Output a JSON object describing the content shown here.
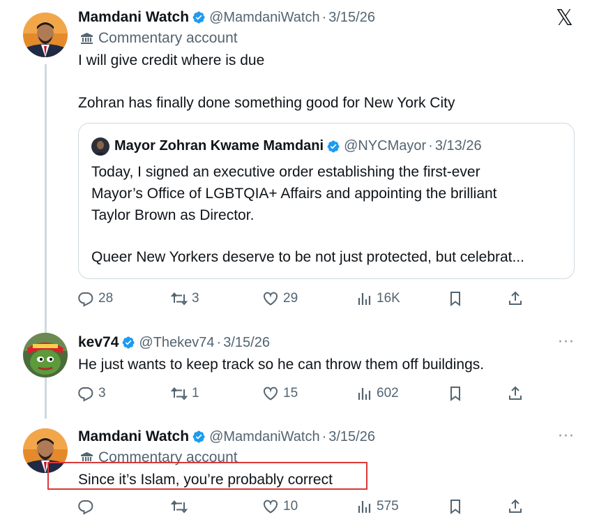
{
  "close_icon_glyph": "𝕏",
  "more_glyph": "···",
  "posts": [
    {
      "name": "Mamdani Watch",
      "handle": "@MamdaniWatch",
      "sep": "·",
      "date": "3/15/26",
      "label": "Commentary account",
      "text_lines": [
        "I will give credit where is due",
        "Zohran has finally done something good for New York City"
      ],
      "quote": {
        "name": "Mayor Zohran Kwame Mamdani",
        "handle": "@NYCMayor",
        "sep": "·",
        "date": "3/13/26",
        "text_lines": [
          "Today, I signed an executive order establishing the first-ever",
          "Mayor’s Office of LGBTQIA+ Affairs and appointing the brilliant",
          "Taylor Brown as Director.",
          "Queer New Yorkers deserve to be not just protected, but celebrat..."
        ]
      },
      "stats": {
        "replies": "28",
        "reposts": "3",
        "likes": "29",
        "views": "16K"
      }
    },
    {
      "name": "kev74",
      "handle": "@Thekev74",
      "sep": "·",
      "date": "3/15/26",
      "text_lines": [
        "He just wants to keep track so he can throw them off buildings."
      ],
      "stats": {
        "replies": "3",
        "reposts": "1",
        "likes": "15",
        "views": "602"
      }
    },
    {
      "name": "Mamdani Watch",
      "handle": "@MamdaniWatch",
      "sep": "·",
      "date": "3/15/26",
      "label": "Commentary account",
      "text_lines": [
        "Since it’s Islam, you’re probably correct"
      ],
      "stats": {
        "replies": "",
        "reposts": "",
        "likes": "10",
        "views": "575"
      }
    }
  ],
  "colors": {
    "verified": "#1d9bf0",
    "text": "#0f1419",
    "muted": "#536471",
    "border": "#cfd9de",
    "highlight": "#d9383a"
  }
}
